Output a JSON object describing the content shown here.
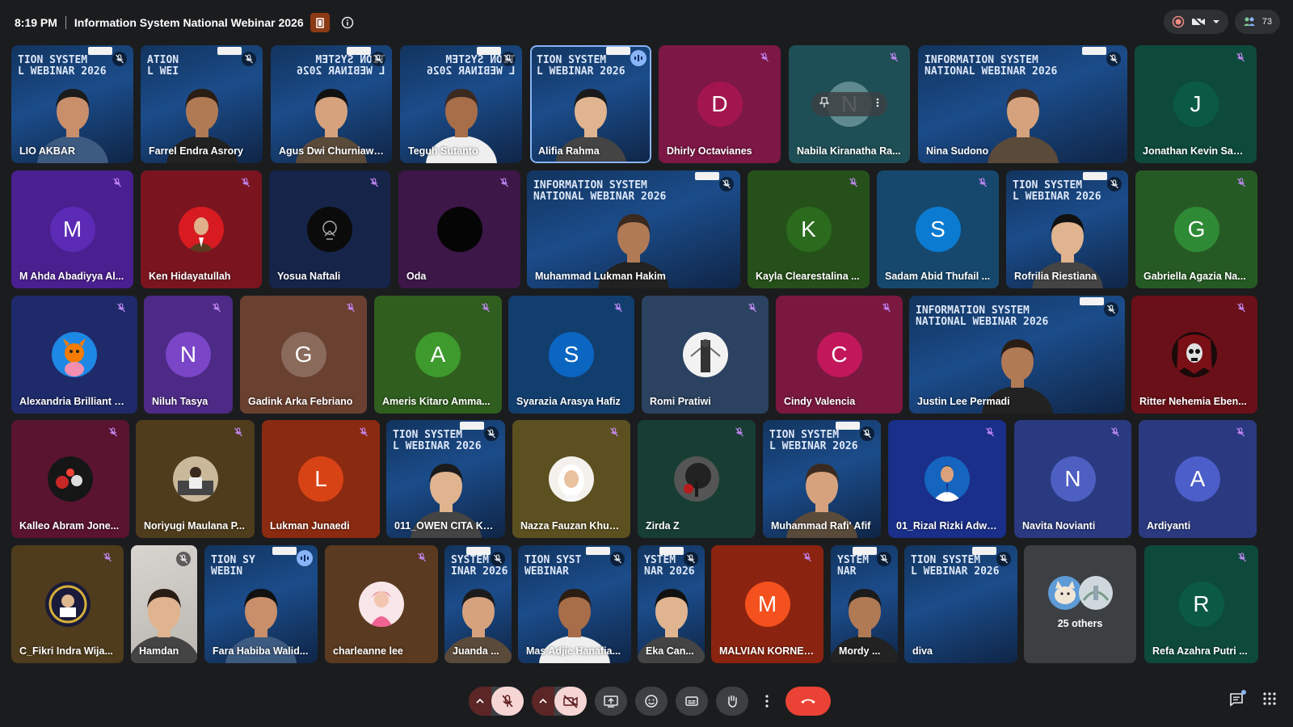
{
  "meeting": {
    "time": "8:19 PM",
    "title": "Information System National Webinar 2026",
    "participant_count": "73"
  },
  "colors": {
    "background": "#1b1c1e",
    "hangup": "#ea4335",
    "accent": "#8ab4f8"
  },
  "banner_text": "INFORMATION SYSTEM\nNATIONAL WEBINAR 2026",
  "banner_short": "TION SYSTEM\nL WEBINAR 2026",
  "banner_short_alt": "ATION\nL WEI",
  "banner_short_mid": "TION SY\nWEBIN",
  "banner_short_jun": "SYSTEM\nINAR 2026",
  "banner_short_ystem": "YSTEM\nNAR 2026",
  "banner_short_ystem2": "YSTEM\nNAR",
  "banner_short_syst": "TION SYST\nWEBINAR",
  "rows": [
    [
      {
        "name": "LIO AKBAR",
        "type": "video",
        "banner": "short"
      },
      {
        "name": "Farrel Endra Asrory",
        "type": "video",
        "banner": "alt"
      },
      {
        "name": "Agus Dwi Churniawan",
        "type": "video",
        "banner": "mirror"
      },
      {
        "name": "Teguh Sutanto",
        "type": "video",
        "banner": "mirror"
      },
      {
        "name": "Alifia Rahma",
        "type": "video",
        "banner": "short",
        "active": true
      },
      {
        "name": "Dhirly Octavianes",
        "type": "avatar",
        "letter": "D",
        "bg": "#a3154e",
        "tile": "#7d1746"
      },
      {
        "name": "Nabila Kiranatha Ra...",
        "type": "pinned",
        "letter": "N",
        "tile": "#1f4f56"
      },
      {
        "name": "Nina Sudono",
        "type": "video",
        "banner": "full"
      },
      {
        "name": "Jonathan Kevin Sant...",
        "type": "avatar",
        "letter": "J",
        "bg": "#0b5a46",
        "tile": "#0e4a3c"
      }
    ],
    [
      {
        "name": "M Ahda Abadiyya Al...",
        "type": "avatar",
        "letter": "M",
        "bg": "#5b2bb5",
        "tile": "#4a1f8f"
      },
      {
        "name": "Ken Hidayatullah",
        "type": "photo",
        "photo": "red-suit",
        "tile": "#7a1520"
      },
      {
        "name": "Yosua Naftali",
        "type": "photo",
        "photo": "black-logo",
        "tile": "#16244a"
      },
      {
        "name": "Oda",
        "type": "photo",
        "photo": "black",
        "tile": "#3c1748"
      },
      {
        "name": "Muhammad Lukman Hakim",
        "type": "video",
        "banner": "full"
      },
      {
        "name": "Kayla Clearestalina ...",
        "type": "avatar",
        "letter": "K",
        "bg": "#2b6b1e",
        "tile": "#26501a"
      },
      {
        "name": "Sadam Abid Thufail ...",
        "type": "avatar",
        "letter": "S",
        "bg": "#0b7bd1",
        "tile": "#16486d"
      },
      {
        "name": "Rofrilia Riestiana",
        "type": "video",
        "banner": "short"
      },
      {
        "name": "Gabriella Agazia Na...",
        "type": "avatar",
        "letter": "G",
        "bg": "#2f8a35",
        "tile": "#265a24"
      }
    ],
    [
      {
        "name": "Alexandria Brilliant C...",
        "type": "photo",
        "photo": "orange-char",
        "tile": "#1e2a6a"
      },
      {
        "name": "Niluh Tasya",
        "type": "avatar",
        "letter": "N",
        "bg": "#7a45c7",
        "tile": "#4c2a85"
      },
      {
        "name": "Gadink Arka Febriano",
        "type": "avatar",
        "letter": "G",
        "bg": "#8a6a5a",
        "tile": "#6a4030"
      },
      {
        "name": "Ameris Kitaro Amma...",
        "type": "avatar",
        "letter": "A",
        "bg": "#3f9a2e",
        "tile": "#2f5e1e"
      },
      {
        "name": "Syarazia Arasya Hafiz",
        "type": "avatar",
        "letter": "S",
        "bg": "#0b66c2",
        "tile": "#123e6e"
      },
      {
        "name": "Romi Pratiwi",
        "type": "photo",
        "photo": "bw-figure",
        "tile": "#2b4260"
      },
      {
        "name": "Cindy Valencia",
        "type": "avatar",
        "letter": "C",
        "bg": "#c2185b",
        "tile": "#7a1840"
      },
      {
        "name": "Justin Lee Permadi",
        "type": "video",
        "banner": "full"
      },
      {
        "name": "Ritter Nehemia Eben...",
        "type": "photo",
        "photo": "skull",
        "tile": "#6a1018"
      }
    ],
    [
      {
        "name": "Kalleo Abram Jone...",
        "type": "photo",
        "photo": "dark-round",
        "tile": "#5a1430"
      },
      {
        "name": "Noriyugi Maulana P...",
        "type": "photo",
        "photo": "desk",
        "tile": "#4e3c1c"
      },
      {
        "name": "Lukman Junaedi",
        "type": "avatar",
        "letter": "L",
        "bg": "#d84315",
        "tile": "#8a2a10"
      },
      {
        "name": "011_OWEN CITA KA...",
        "type": "video",
        "banner": "short"
      },
      {
        "name": "Nazza Fauzan Khuri...",
        "type": "photo",
        "photo": "hijab",
        "tile": "#5c5020"
      },
      {
        "name": "Zirda Z",
        "type": "photo",
        "photo": "tree",
        "tile": "#183e34"
      },
      {
        "name": "Muhammad Rafi' Afif",
        "type": "video",
        "banner": "short"
      },
      {
        "name": "01_Rizal Rizki Adwit...",
        "type": "photo",
        "photo": "blue-shirt",
        "tile": "#1a2f8a"
      },
      {
        "name": "Navita Novianti",
        "type": "avatar",
        "letter": "N",
        "bg": "#4e5fc2",
        "tile": "#2a3a80"
      },
      {
        "name": "Ardiyanti",
        "type": "avatar",
        "letter": "A",
        "bg": "#4b5ec9",
        "tile": "#2b3a80"
      }
    ],
    [
      {
        "name": "C_Fikri Indra Wija...",
        "type": "photo",
        "photo": "badge",
        "tile": "#4e3c1c"
      },
      {
        "name": "Hamdan",
        "type": "video",
        "banner": "none",
        "light": true
      },
      {
        "name": "Fara Habiba Walid...",
        "type": "video",
        "banner": "mid",
        "speaking": true
      },
      {
        "name": "charleanne lee",
        "type": "photo",
        "photo": "pink-doll",
        "tile": "#5a3a20"
      },
      {
        "name": "Juanda ...",
        "type": "video",
        "banner": "jun"
      },
      {
        "name": "Mas Adjie Hanafia...",
        "type": "video",
        "banner": "syst"
      },
      {
        "name": "Eka Can...",
        "type": "video",
        "banner": "ystem"
      },
      {
        "name": "MALVIAN KORNEL...",
        "type": "avatar",
        "letter": "M",
        "bg": "#f4511e",
        "tile": "#8a2410"
      },
      {
        "name": "Mordy ...",
        "type": "video",
        "banner": "ystem2"
      },
      {
        "name": "diva",
        "type": "video",
        "banner": "short",
        "empty": true
      },
      {
        "name": "25 others",
        "type": "others"
      },
      {
        "name": "Refa Azahra Putri ...",
        "type": "avatar",
        "letter": "R",
        "bg": "#0b5a46",
        "tile": "#0e4a3c"
      }
    ]
  ],
  "others_label": "25 others"
}
